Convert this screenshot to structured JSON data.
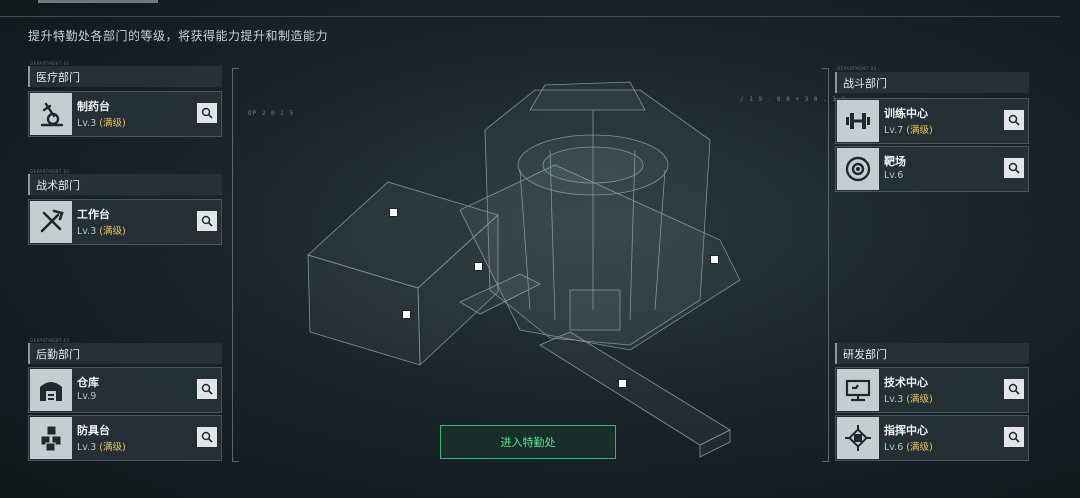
{
  "subtitle": "提升特勤处各部门的等级，将获得能力提升和制造能力",
  "departments": {
    "medical": {
      "tag": "DEPARTMENT 01",
      "title": "医疗部门",
      "items": [
        {
          "name": "制药台",
          "level": "Lv.3",
          "max": "(满级)"
        }
      ]
    },
    "tactical": {
      "tag": "DEPARTMENT 02",
      "title": "战术部门",
      "items": [
        {
          "name": "工作台",
          "level": "Lv.3",
          "max": "(满级)"
        }
      ]
    },
    "logistics": {
      "tag": "DEPARTMENT 03",
      "title": "后勤部门",
      "items": [
        {
          "name": "仓库",
          "level": "Lv.9"
        },
        {
          "name": "防具台",
          "level": "Lv.3",
          "max": "(满级)"
        }
      ]
    },
    "combat": {
      "tag": "DEPARTMENT 04",
      "title": "战斗部门",
      "items": [
        {
          "name": "训练中心",
          "level": "Lv.7",
          "max": "(满级)"
        },
        {
          "name": "靶场",
          "level": "Lv.6"
        }
      ]
    },
    "research": {
      "title": "研发部门",
      "items": [
        {
          "name": "技术中心",
          "level": "Lv.3",
          "max": "(满级)"
        },
        {
          "name": "指挥中心",
          "level": "Lv.6",
          "max": "(满级)"
        }
      ]
    }
  },
  "enter_button": "进入特勤处",
  "hud": {
    "code": "OP 2 0 2 5",
    "coord": "/ 1 9 . 8 8 + 3 0 . 3 3"
  },
  "icons": [
    "microscope-icon",
    "tools-icon",
    "warehouse-icon",
    "cubes-icon",
    "dumbbell-icon",
    "target-icon",
    "computer-icon",
    "chip-icon",
    "search-icon"
  ]
}
